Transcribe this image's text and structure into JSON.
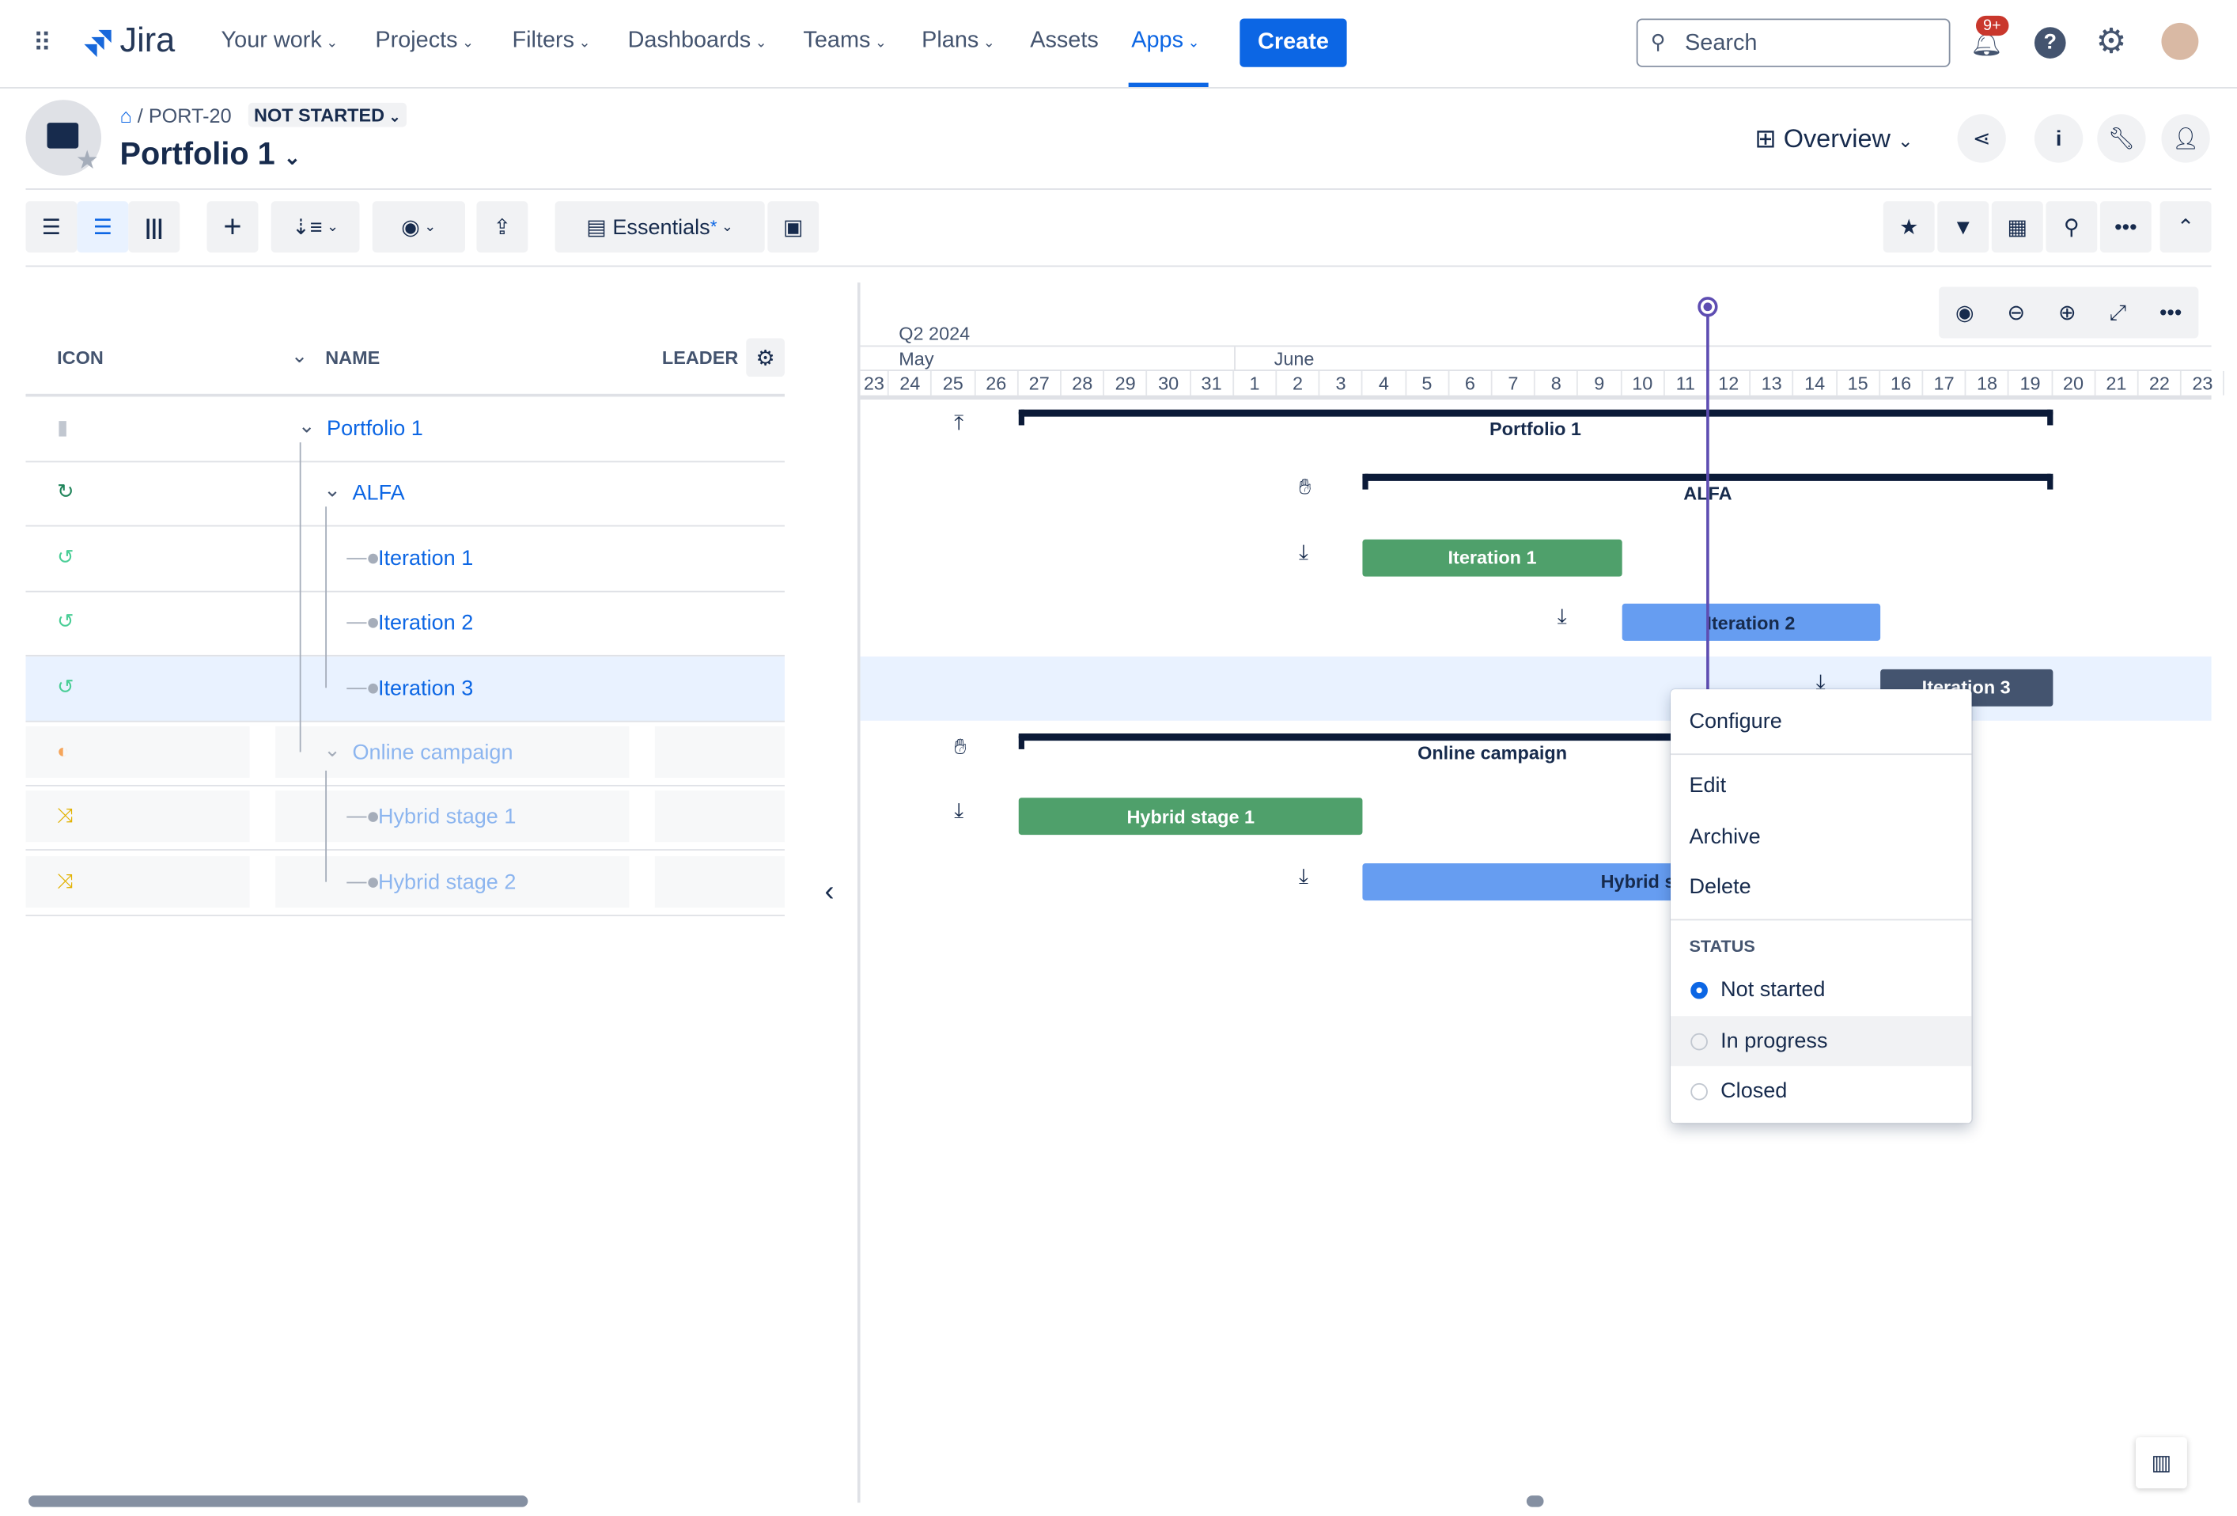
{
  "nav": {
    "logo": "Jira",
    "items": [
      {
        "label": "Your work",
        "chev": true
      },
      {
        "label": "Projects",
        "chev": true
      },
      {
        "label": "Filters",
        "chev": true
      },
      {
        "label": "Dashboards",
        "chev": true
      },
      {
        "label": "Teams",
        "chev": true
      },
      {
        "label": "Plans",
        "chev": true
      },
      {
        "label": "Assets",
        "chev": false
      },
      {
        "label": "Apps",
        "chev": true,
        "active": true
      }
    ],
    "create": "Create",
    "search_placeholder": "Search",
    "notif_badge": "9+"
  },
  "header": {
    "breadcrumb_id": "PORT-20",
    "status": "NOT STARTED",
    "title": "Portfolio 1",
    "view": "Overview"
  },
  "toolbar": {
    "view_preset": "Essentials",
    "preset_modified": "*"
  },
  "table": {
    "columns": {
      "icon": "ICON",
      "name": "NAME",
      "leader": "LEADER"
    },
    "rows": [
      {
        "name": "Portfolio 1",
        "icon": "briefcase-icon",
        "icon_color": "#c1c7d0",
        "level": 0,
        "expand": true,
        "faded": false
      },
      {
        "name": "ALFA",
        "icon": "refresh-icon",
        "icon_color": "#1f845a",
        "level": 1,
        "expand": true,
        "faded": false
      },
      {
        "name": "Iteration 1",
        "icon": "history-icon",
        "icon_color": "#4bce97",
        "level": 2,
        "faded": false
      },
      {
        "name": "Iteration 2",
        "icon": "history-icon",
        "icon_color": "#4bce97",
        "level": 2,
        "faded": false
      },
      {
        "name": "Iteration 3",
        "icon": "history-icon",
        "icon_color": "#4bce97",
        "level": 2,
        "faded": false,
        "selected": true
      },
      {
        "name": "Online campaign",
        "icon": "half-circle-icon",
        "icon_color": "#f5a55a",
        "level": 1,
        "expand": true,
        "faded": true
      },
      {
        "name": "Hybrid stage 1",
        "icon": "shuffle-icon",
        "icon_color": "#e2b203",
        "level": 2,
        "faded": true
      },
      {
        "name": "Hybrid stage 2",
        "icon": "shuffle-icon",
        "icon_color": "#e2b203",
        "level": 2,
        "faded": true
      }
    ]
  },
  "timeline": {
    "quarter": "Q2 2024",
    "months": [
      {
        "label": "May",
        "first_day": "May 23"
      },
      {
        "label": "June",
        "first_day": "June 1"
      }
    ],
    "days": [
      "23",
      "24",
      "25",
      "26",
      "27",
      "28",
      "29",
      "30",
      "31",
      "1",
      "2",
      "3",
      "4",
      "5",
      "6",
      "7",
      "8",
      "9",
      "10",
      "11",
      "12",
      "13",
      "14",
      "15",
      "16",
      "17",
      "18",
      "19",
      "20",
      "21",
      "22",
      "23"
    ],
    "today": "2024-06-12",
    "items": [
      {
        "label": "Portfolio 1",
        "type": "group",
        "start": "2024-05-27",
        "end": "2024-06-20",
        "handle": "arrow-up-icon"
      },
      {
        "label": "ALFA",
        "type": "group",
        "start": "2024-06-04",
        "end": "2024-06-20",
        "handle": "hand-icon"
      },
      {
        "label": "Iteration 1",
        "type": "bar",
        "color": "#4fa06b",
        "text_color": "#ffffff",
        "start": "2024-06-04",
        "end": "2024-06-10",
        "handle": "arrow-down-icon"
      },
      {
        "label": "Iteration 2",
        "type": "bar",
        "color": "#669df1",
        "text_color": "#172b4d",
        "start": "2024-06-10",
        "end": "2024-06-16",
        "handle": "arrow-down-icon"
      },
      {
        "label": "Iteration 3",
        "type": "bar",
        "color": "#44546f",
        "text_color": "#ffffff",
        "start": "2024-06-16",
        "end": "2024-06-20",
        "handle": "arrow-down-icon"
      },
      {
        "label": "Online campaign",
        "type": "group",
        "start": "2024-05-27",
        "end": "2024-06-18",
        "handle": "hand-icon"
      },
      {
        "label": "Hybrid stage 1",
        "type": "bar",
        "color": "#4fa06b",
        "text_color": "#ffffff",
        "start": "2024-05-27",
        "end": "2024-06-04",
        "handle": "arrow-down-icon"
      },
      {
        "label": "Hybrid stage 2",
        "type": "bar",
        "color": "#669df1",
        "text_color": "#172b4d",
        "start": "2024-06-04",
        "end": "2024-06-18",
        "handle": "arrow-down-icon"
      }
    ]
  },
  "context_menu": {
    "configure": "Configure",
    "edit": "Edit",
    "archive": "Archive",
    "delete": "Delete",
    "status_header": "STATUS",
    "statuses": [
      {
        "label": "Not started",
        "selected": true
      },
      {
        "label": "In progress",
        "selected": false
      },
      {
        "label": "Closed",
        "selected": false
      }
    ]
  }
}
